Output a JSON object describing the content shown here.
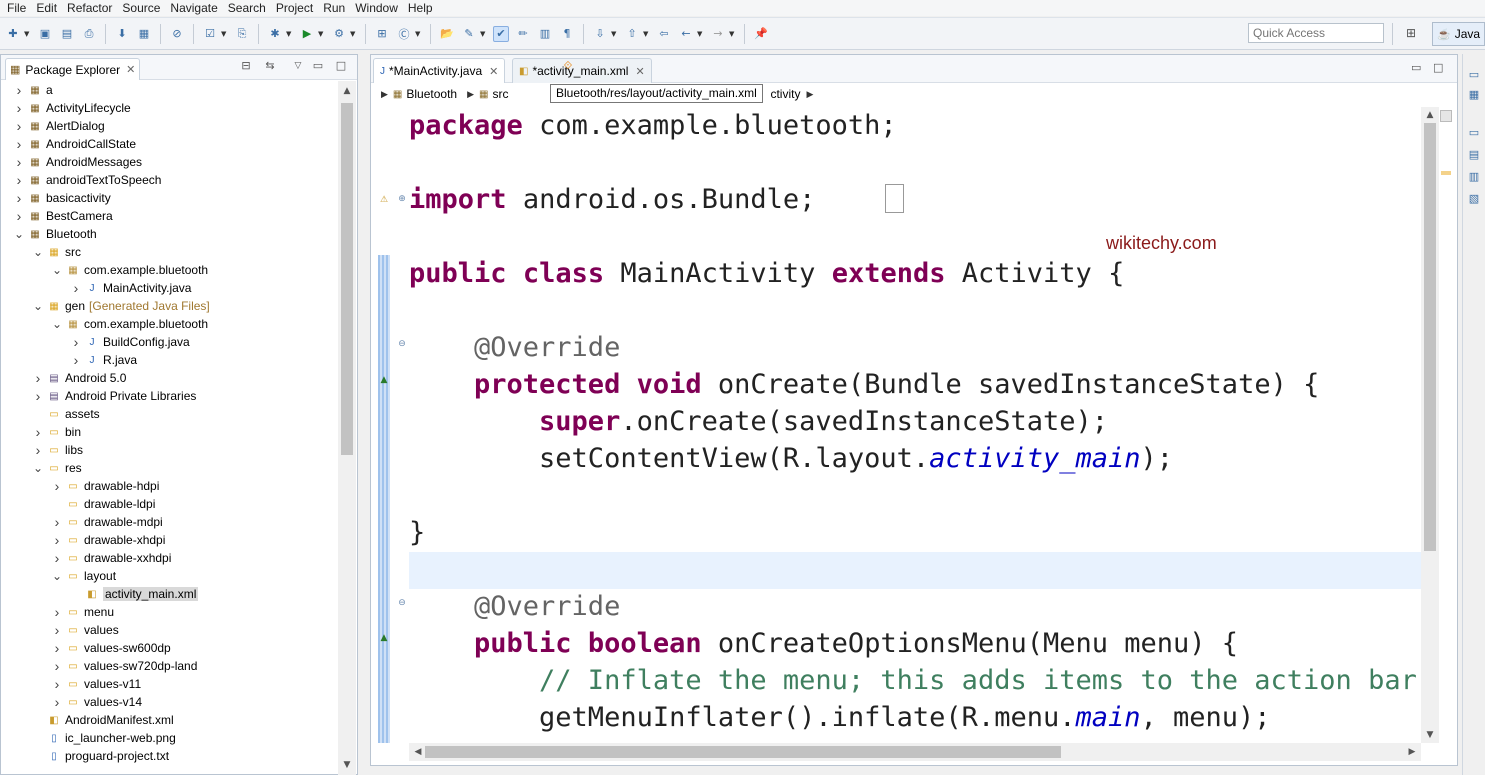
{
  "menu": [
    "File",
    "Edit",
    "Refactor",
    "Source",
    "Navigate",
    "Search",
    "Project",
    "Run",
    "Window",
    "Help"
  ],
  "toolbar": {
    "quick_access_placeholder": "Quick Access",
    "perspective_label": "Java"
  },
  "package_explorer": {
    "title": "Package Explorer",
    "items": [
      {
        "label": "a",
        "sub": "",
        "depth": 0,
        "arrow": "right",
        "icon": "project"
      },
      {
        "label": "ActivityLifecycle",
        "sub": "",
        "depth": 0,
        "arrow": "right",
        "icon": "project"
      },
      {
        "label": "AlertDialog",
        "sub": "",
        "depth": 0,
        "arrow": "right",
        "icon": "project"
      },
      {
        "label": "AndroidCallState",
        "sub": "",
        "depth": 0,
        "arrow": "right",
        "icon": "project"
      },
      {
        "label": "AndroidMessages",
        "sub": "",
        "depth": 0,
        "arrow": "right",
        "icon": "project"
      },
      {
        "label": "androidTextToSpeech",
        "sub": "",
        "depth": 0,
        "arrow": "right",
        "icon": "project"
      },
      {
        "label": "basicactivity",
        "sub": "",
        "depth": 0,
        "arrow": "right",
        "icon": "project"
      },
      {
        "label": "BestCamera",
        "sub": "",
        "depth": 0,
        "arrow": "right",
        "icon": "project"
      },
      {
        "label": "Bluetooth",
        "sub": "",
        "depth": 0,
        "arrow": "down",
        "icon": "project"
      },
      {
        "label": "src",
        "sub": "",
        "depth": 1,
        "arrow": "down",
        "icon": "srcfolder"
      },
      {
        "label": "com.example.bluetooth",
        "sub": "",
        "depth": 2,
        "arrow": "down",
        "icon": "package"
      },
      {
        "label": "MainActivity.java",
        "sub": "",
        "depth": 3,
        "arrow": "right",
        "icon": "java"
      },
      {
        "label": "gen",
        "sub": "[Generated Java Files]",
        "depth": 1,
        "arrow": "down",
        "icon": "srcfolder"
      },
      {
        "label": "com.example.bluetooth",
        "sub": "",
        "depth": 2,
        "arrow": "down",
        "icon": "package"
      },
      {
        "label": "BuildConfig.java",
        "sub": "",
        "depth": 3,
        "arrow": "right",
        "icon": "java"
      },
      {
        "label": "R.java",
        "sub": "",
        "depth": 3,
        "arrow": "right",
        "icon": "java"
      },
      {
        "label": "Android 5.0",
        "sub": "",
        "depth": 1,
        "arrow": "right",
        "icon": "library"
      },
      {
        "label": "Android Private Libraries",
        "sub": "",
        "depth": 1,
        "arrow": "right",
        "icon": "library"
      },
      {
        "label": "assets",
        "sub": "",
        "depth": 1,
        "arrow": "none",
        "icon": "folder"
      },
      {
        "label": "bin",
        "sub": "",
        "depth": 1,
        "arrow": "right",
        "icon": "folder"
      },
      {
        "label": "libs",
        "sub": "",
        "depth": 1,
        "arrow": "right",
        "icon": "folder"
      },
      {
        "label": "res",
        "sub": "",
        "depth": 1,
        "arrow": "down",
        "icon": "folder"
      },
      {
        "label": "drawable-hdpi",
        "sub": "",
        "depth": 2,
        "arrow": "right",
        "icon": "folder"
      },
      {
        "label": "drawable-ldpi",
        "sub": "",
        "depth": 2,
        "arrow": "none",
        "icon": "folder"
      },
      {
        "label": "drawable-mdpi",
        "sub": "",
        "depth": 2,
        "arrow": "right",
        "icon": "folder"
      },
      {
        "label": "drawable-xhdpi",
        "sub": "",
        "depth": 2,
        "arrow": "right",
        "icon": "folder"
      },
      {
        "label": "drawable-xxhdpi",
        "sub": "",
        "depth": 2,
        "arrow": "right",
        "icon": "folder"
      },
      {
        "label": "layout",
        "sub": "",
        "depth": 2,
        "arrow": "down",
        "icon": "folder"
      },
      {
        "label": "activity_main.xml",
        "sub": "",
        "depth": 3,
        "arrow": "none",
        "icon": "xml",
        "selected": true
      },
      {
        "label": "menu",
        "sub": "",
        "depth": 2,
        "arrow": "right",
        "icon": "folder"
      },
      {
        "label": "values",
        "sub": "",
        "depth": 2,
        "arrow": "right",
        "icon": "folder"
      },
      {
        "label": "values-sw600dp",
        "sub": "",
        "depth": 2,
        "arrow": "right",
        "icon": "folder"
      },
      {
        "label": "values-sw720dp-land",
        "sub": "",
        "depth": 2,
        "arrow": "right",
        "icon": "folder"
      },
      {
        "label": "values-v11",
        "sub": "",
        "depth": 2,
        "arrow": "right",
        "icon": "folder"
      },
      {
        "label": "values-v14",
        "sub": "",
        "depth": 2,
        "arrow": "right",
        "icon": "folder"
      },
      {
        "label": "AndroidManifest.xml",
        "sub": "",
        "depth": 1,
        "arrow": "none",
        "icon": "xml"
      },
      {
        "label": "ic_launcher-web.png",
        "sub": "",
        "depth": 1,
        "arrow": "none",
        "icon": "file"
      },
      {
        "label": "proguard-project.txt",
        "sub": "",
        "depth": 1,
        "arrow": "none",
        "icon": "file"
      }
    ]
  },
  "editor": {
    "tabs": [
      {
        "label": "*MainActivity.java",
        "active": true
      },
      {
        "label": "*activity_main.xml",
        "active": false
      }
    ],
    "breadcrumbs": [
      "Bluetooth",
      "src"
    ],
    "breadcrumb_tail": "ctivity",
    "tooltip": "Bluetooth/res/layout/activity_main.xml",
    "watermark": "wikitechy.com",
    "code": [
      [
        [
          "kw",
          "package"
        ],
        [
          "",
          "com.example.bluetooth;"
        ]
      ],
      [],
      [
        [
          "kw",
          "import"
        ],
        [
          "",
          "android.os.Bundle;"
        ]
      ],
      [],
      [
        [
          "kw",
          "public"
        ],
        [
          "",
          ""
        ],
        [
          "kw",
          "class"
        ],
        [
          "",
          "MainActivity"
        ],
        [
          "kw",
          "extends"
        ],
        [
          "",
          "Activity {"
        ]
      ],
      [],
      [
        [
          "an",
          "    @Override"
        ]
      ],
      [
        [
          "kw",
          "    protected"
        ],
        [
          "kw",
          "void"
        ],
        [
          "",
          "onCreate(Bundle savedInstanceState) {"
        ]
      ],
      [
        [
          "kw",
          "        super"
        ],
        [
          "",
          ".onCreate(savedInstanceState);"
        ]
      ],
      [
        [
          "",
          "        setContentView(R.layout."
        ],
        [
          "fi",
          "activity_main"
        ],
        [
          "",
          ");"
        ]
      ],
      [],
      [
        [
          "",
          "}"
        ]
      ],
      [],
      [
        [
          "an",
          "    @Override"
        ]
      ],
      [
        [
          "kw",
          "    public"
        ],
        [
          "kw",
          "boolean"
        ],
        [
          "",
          "onCreateOptionsMenu(Menu menu) {"
        ]
      ],
      [
        [
          "cm",
          "        // Inflate the menu; this adds items to the action bar if it is present."
        ]
      ],
      [
        [
          "",
          "        getMenuInflater().inflate(R.menu."
        ],
        [
          "fi",
          "main"
        ],
        [
          "",
          ", menu);"
        ]
      ]
    ]
  }
}
